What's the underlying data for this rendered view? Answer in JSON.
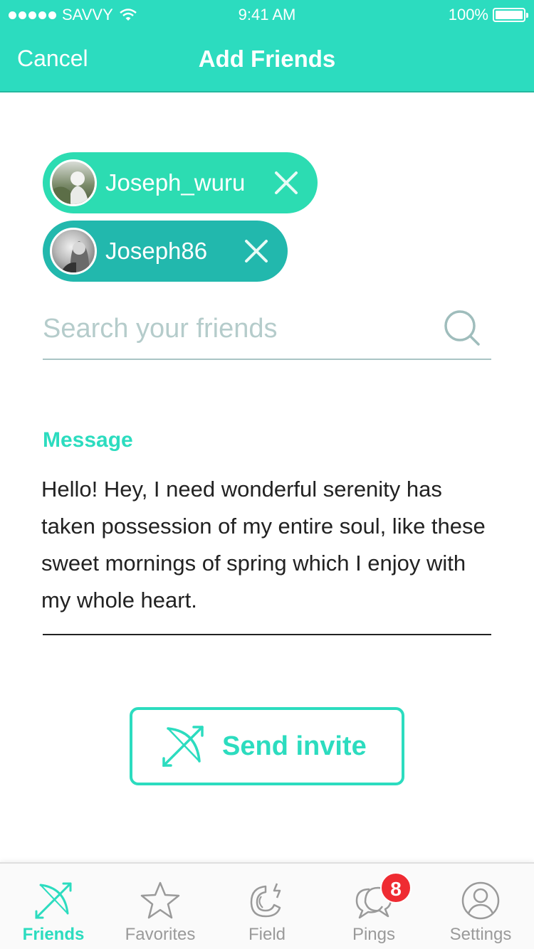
{
  "status_bar": {
    "carrier": "SAVVY",
    "time": "9:41 AM",
    "battery": "100%"
  },
  "nav": {
    "cancel_label": "Cancel",
    "title": "Add Friends"
  },
  "selected_friends": [
    {
      "name": "Joseph_wuru"
    },
    {
      "name": "Joseph86"
    }
  ],
  "search": {
    "placeholder": "Search your friends",
    "value": ""
  },
  "message": {
    "label": "Message",
    "text": "Hello! Hey, I need wonderful serenity has taken possession of my entire soul, like these sweet mornings of spring which I enjoy with my whole heart."
  },
  "send_button": {
    "label": "Send invite",
    "icon": "bow-arrow-icon"
  },
  "tabbar": {
    "items": [
      {
        "label": "Friends",
        "icon": "bow-arrow-icon",
        "active": true
      },
      {
        "label": "Favorites",
        "icon": "star-icon",
        "active": false
      },
      {
        "label": "Field",
        "icon": "magnet-icon",
        "active": false
      },
      {
        "label": "Pings",
        "icon": "chat-bubbles-icon",
        "active": false,
        "badge": "8"
      },
      {
        "label": "Settings",
        "icon": "user-icon",
        "active": false
      }
    ]
  },
  "colors": {
    "accent": "#2cdcbf",
    "chip_primary": "#2cdcb2",
    "chip_secondary": "#22b8ad",
    "badge": "#ef2b32",
    "inactive": "#9a9a9a"
  }
}
